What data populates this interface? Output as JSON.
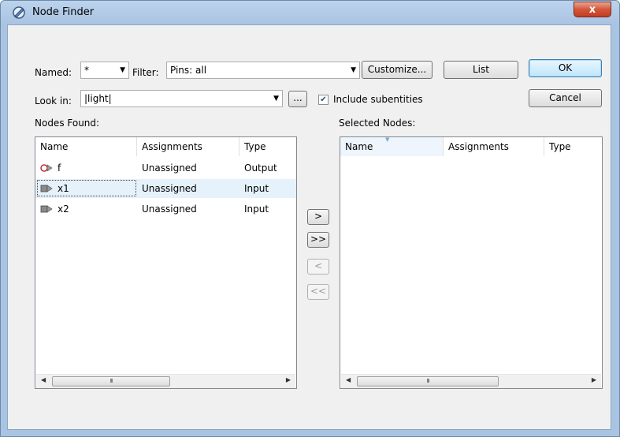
{
  "window": {
    "title": "Node Finder",
    "close_label": "x"
  },
  "controls": {
    "named_label": "Named:",
    "named_value": "*",
    "filter_label": "Filter:",
    "filter_value": "Pins: all",
    "customize_label": "Customize...",
    "list_label": "List",
    "ok_label": "OK",
    "cancel_label": "Cancel",
    "look_in_label": "Look in:",
    "look_in_value": "|light|",
    "browse_label": "...",
    "include_subentities_label": "Include subentities",
    "include_subentities_checked": true
  },
  "nodes_found": {
    "label": "Nodes Found:",
    "columns": [
      "Name",
      "Assignments",
      "Type"
    ],
    "rows": [
      {
        "name": "f",
        "assignment": "Unassigned",
        "type": "Output",
        "icon": "output-pin-icon"
      },
      {
        "name": "x1",
        "assignment": "Unassigned",
        "type": "Input",
        "icon": "input-pin-icon",
        "selected": true
      },
      {
        "name": "x2",
        "assignment": "Unassigned",
        "type": "Input",
        "icon": "input-pin-icon"
      }
    ]
  },
  "transfer": {
    "add_one": ">",
    "add_all": ">>",
    "remove_one": "<",
    "remove_all": "<<"
  },
  "selected_nodes": {
    "label": "Selected Nodes:",
    "columns": [
      "Name",
      "Assignments",
      "Type"
    ],
    "rows": []
  },
  "colors": {
    "selected_row": "#e5f1fb",
    "ok_border": "#3c7fb1",
    "close_red": "#c23d22"
  }
}
